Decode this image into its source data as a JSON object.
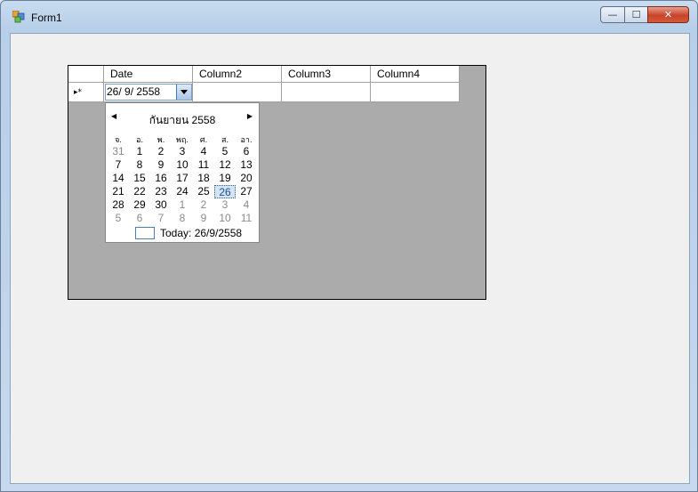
{
  "window": {
    "title": "Form1",
    "min_glyph": "—",
    "max_glyph": "☐",
    "close_glyph": "✕"
  },
  "grid": {
    "columns": [
      "Date",
      "Column2",
      "Column3",
      "Column4"
    ],
    "new_row_marker": "▸*",
    "date_value": "26/  9/  2558"
  },
  "calendar": {
    "month_title": "กันยายน 2558",
    "prev_glyph": "◀",
    "next_glyph": "▶",
    "weekdays": [
      "จ.",
      "อ.",
      "พ.",
      "พฤ.",
      "ศ.",
      "ส.",
      "อา."
    ],
    "weeks": [
      [
        "31",
        "1",
        "2",
        "3",
        "4",
        "5",
        "6"
      ],
      [
        "7",
        "8",
        "9",
        "10",
        "11",
        "12",
        "13"
      ],
      [
        "14",
        "15",
        "16",
        "17",
        "18",
        "19",
        "20"
      ],
      [
        "21",
        "22",
        "23",
        "24",
        "25",
        "26",
        "27"
      ],
      [
        "28",
        "29",
        "30",
        "1",
        "2",
        "3",
        "4"
      ],
      [
        "5",
        "6",
        "7",
        "8",
        "9",
        "10",
        "11"
      ]
    ],
    "other_month": [
      [
        0,
        0
      ],
      [
        4,
        3
      ],
      [
        4,
        4
      ],
      [
        4,
        5
      ],
      [
        4,
        6
      ],
      [
        5,
        0
      ],
      [
        5,
        1
      ],
      [
        5,
        2
      ],
      [
        5,
        3
      ],
      [
        5,
        4
      ],
      [
        5,
        5
      ],
      [
        5,
        6
      ]
    ],
    "selected": [
      3,
      5
    ],
    "today_label": "Today: 26/9/2558"
  }
}
